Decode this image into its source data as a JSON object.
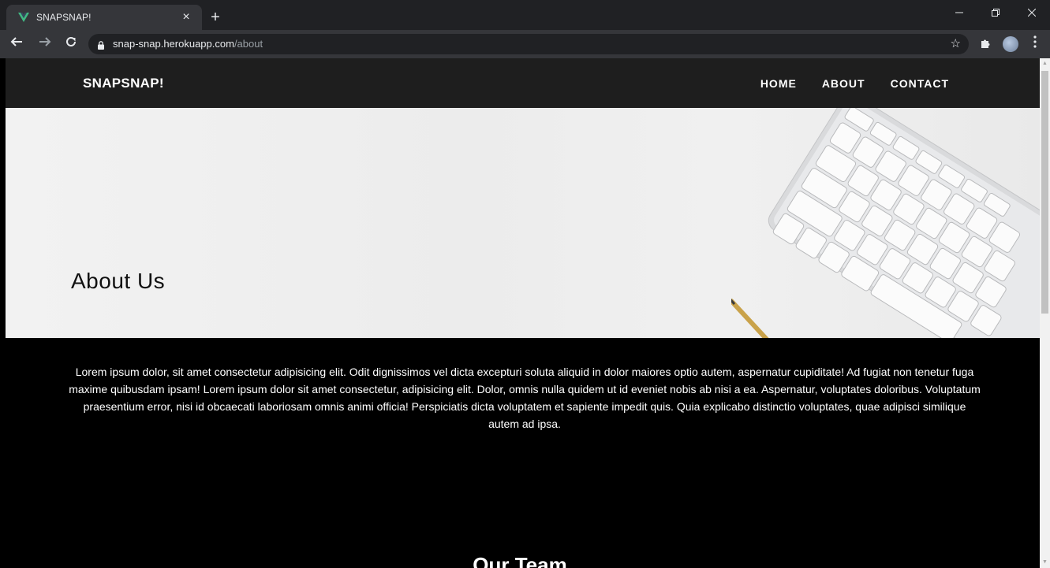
{
  "browser": {
    "tab_title": "SNAPSNAP!",
    "tab_close": "×",
    "new_tab": "+",
    "url_domain": "snap-snap.herokuapp.com",
    "url_path": "/about",
    "icons": [
      "vue-logo-icon",
      "back-arrow-icon",
      "forward-arrow-icon",
      "reload-icon",
      "lock-icon",
      "star-icon",
      "extensions-icon",
      "profile-avatar-icon",
      "kebab-menu-icon",
      "minimize-icon",
      "restore-icon",
      "close-icon"
    ]
  },
  "nav": {
    "brand": "SNAPSNAP!",
    "links": [
      "HOME",
      "ABOUT",
      "CONTACT"
    ]
  },
  "hero": {
    "title": "About Us"
  },
  "about": {
    "body": "Lorem ipsum dolor, sit amet consectetur adipisicing elit. Odit dignissimos vel dicta excepturi soluta aliquid in dolor maiores optio autem, aspernatur cupiditate! Ad fugiat non tenetur fuga maxime quibusdam ipsam! Lorem ipsum dolor sit amet consectetur, adipisicing elit. Dolor, omnis nulla quidem ut id eveniet nobis ab nisi a ea. Aspernatur, voluptates doloribus. Voluptatum praesentium error, nisi id obcaecati laboriosam omnis animi officia! Perspiciatis dicta voluptatem et sapiente impedit quis. Quia explicabo distinctio voluptates, quae adipisci similique autem ad ipsa."
  },
  "team": {
    "title": "Our Team"
  },
  "colors": {
    "nav_bg": "#1e1e1e",
    "page_bg": "#000000",
    "vue_green": "#41b883"
  }
}
